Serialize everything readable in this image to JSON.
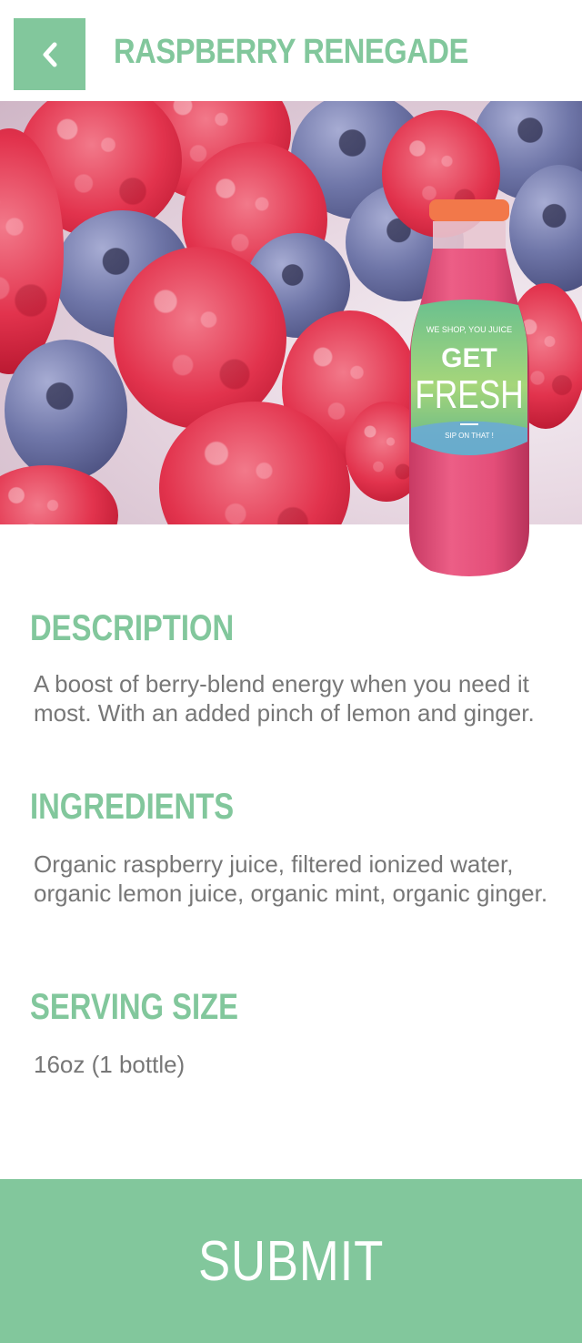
{
  "header": {
    "title": "RASPBERRY RENEGADE",
    "back_icon": "chevron-left-icon"
  },
  "hero": {
    "label_line1": "WE SHOP, YOU JUICE",
    "label_line2": "GET",
    "label_line3": "FRESH",
    "label_line4": "SIP ON THAT !"
  },
  "description": {
    "title": "DESCRIPTION",
    "text": "A boost of berry-blend energy when you need it most. With an added pinch of lemon and ginger."
  },
  "ingredients": {
    "title": "INGREDIENTS",
    "text": "Organic raspberry juice, filtered ionized water, organic lemon juice, organic mint, organic ginger."
  },
  "serving": {
    "title": "SERVING SIZE",
    "text": "16oz (1 bottle)"
  },
  "submit": {
    "label": "SUBMIT"
  },
  "colors": {
    "accent": "#82c79c",
    "text": "#777777"
  }
}
